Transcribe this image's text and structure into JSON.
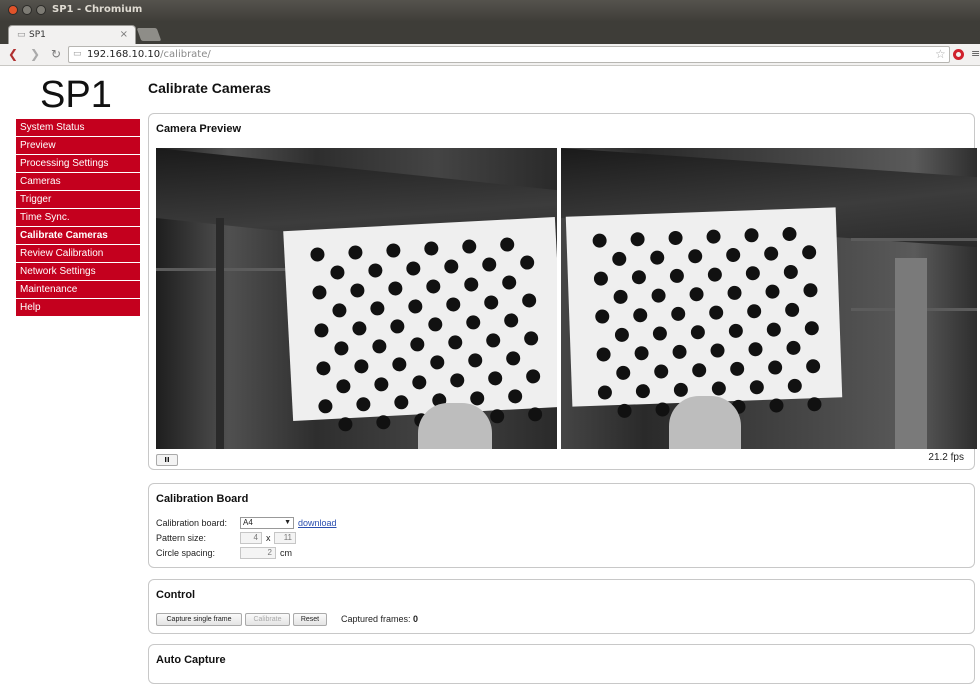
{
  "window": {
    "title": "SP1 - Chromium"
  },
  "tab": {
    "title": "SP1",
    "close_glyph": "×"
  },
  "toolbar": {
    "url_host": "192.168.10.10",
    "url_path": "/calibrate/",
    "back_icon": "back-arrow-icon",
    "forward_icon": "forward-arrow-icon",
    "reload_icon": "reload-icon"
  },
  "site": {
    "logo": "SP1"
  },
  "nav": {
    "items": [
      {
        "label": "System Status"
      },
      {
        "label": "Preview"
      },
      {
        "label": "Processing Settings"
      },
      {
        "label": "Cameras"
      },
      {
        "label": "Trigger"
      },
      {
        "label": "Time Sync."
      },
      {
        "label": "Calibrate Cameras",
        "active": true
      },
      {
        "label": "Review Calibration"
      },
      {
        "label": "Network Settings"
      },
      {
        "label": "Maintenance"
      },
      {
        "label": "Help"
      }
    ],
    "color": "#c4001e"
  },
  "page": {
    "title": "Calibrate Cameras"
  },
  "preview": {
    "heading": "Camera Preview",
    "pause_label": "II",
    "fps": "21.2 fps"
  },
  "calibration_board": {
    "heading": "Calibration Board",
    "board_label": "Calibration board:",
    "board_value": "A4",
    "download_label": "download",
    "pattern_label": "Pattern size:",
    "pattern_cols": "4",
    "pattern_x": "x",
    "pattern_rows": "11",
    "spacing_label": "Circle spacing:",
    "spacing_value": "2",
    "spacing_unit": "cm"
  },
  "control": {
    "heading": "Control",
    "capture_label": "Capture single frame",
    "calibrate_label": "Calibrate",
    "reset_label": "Reset",
    "captured_label": "Captured frames:",
    "captured_value": "0"
  },
  "auto_capture": {
    "heading": "Auto Capture"
  }
}
